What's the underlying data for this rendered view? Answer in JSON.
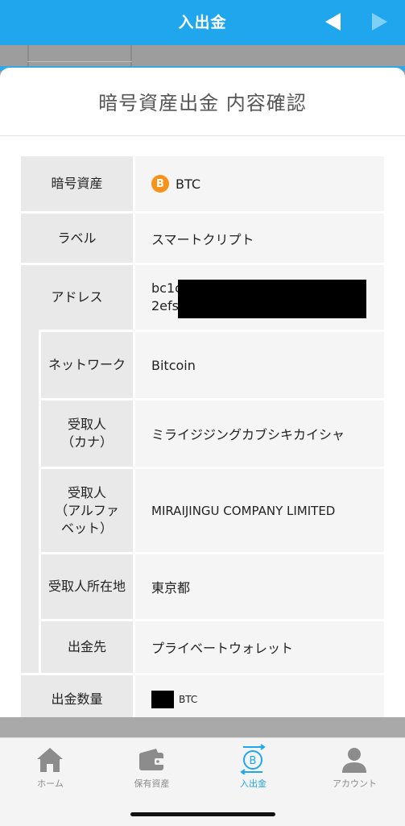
{
  "header": {
    "title": "入出金"
  },
  "modal": {
    "title": "暗号資産出金 内容確認"
  },
  "rows": {
    "asset": {
      "label": "暗号資産",
      "value": "BTC",
      "icon": "bitcoin-icon",
      "icon_glyph": "B"
    },
    "label": {
      "label": "ラベル",
      "value": "スマートクリプト"
    },
    "address": {
      "label": "アドレス",
      "line1": "bc1c",
      "line2": "2efs"
    },
    "network": {
      "label": "ネットワーク",
      "value": "Bitcoin"
    },
    "recipient_kana": {
      "label_line1": "受取人",
      "label_line2": "（カナ）",
      "value": "ミライジジングカブシキカイシャ"
    },
    "recipient_alpha": {
      "label_line1": "受取人",
      "label_line2": "（アルファ",
      "label_line3": "ベット）",
      "value": "MIRAIJINGU COMPANY LIMITED"
    },
    "recipient_address": {
      "label": "受取人所在地",
      "value": "東京都"
    },
    "destination": {
      "label": "出金先",
      "value": "プライベートウォレット"
    },
    "amount": {
      "label": "出金数量",
      "unit": "BTC"
    }
  },
  "tabs": [
    {
      "label": "ホーム",
      "icon": "home-icon"
    },
    {
      "label": "保有資産",
      "icon": "wallet-icon"
    },
    {
      "label": "入出金",
      "icon": "deposit-withdraw-icon"
    },
    {
      "label": "アカウント",
      "icon": "account-icon"
    }
  ],
  "colors": {
    "primary": "#1fa6ec",
    "bitcoin": "#f6931a",
    "label_bg": "#e9e9e9",
    "value_bg": "#f5f5f5"
  }
}
